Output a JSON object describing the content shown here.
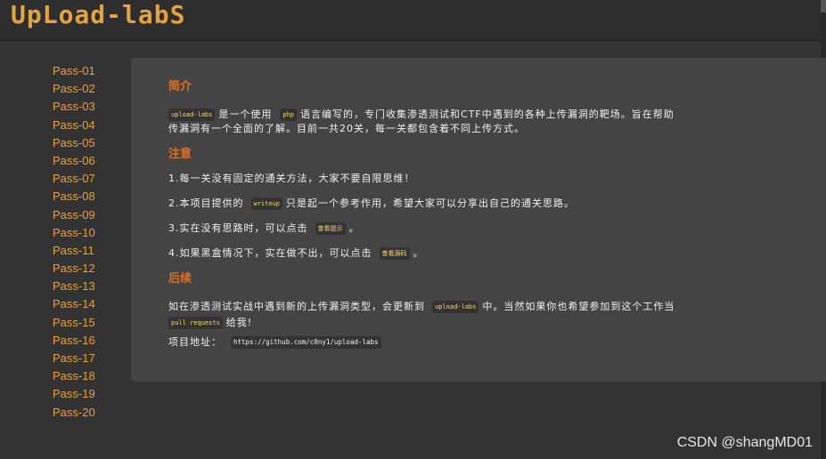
{
  "header": {
    "logo_text": "UpLoad-labS"
  },
  "sidebar": {
    "items": [
      {
        "label": "Pass-01"
      },
      {
        "label": "Pass-02"
      },
      {
        "label": "Pass-03"
      },
      {
        "label": "Pass-04"
      },
      {
        "label": "Pass-05"
      },
      {
        "label": "Pass-06"
      },
      {
        "label": "Pass-07"
      },
      {
        "label": "Pass-08"
      },
      {
        "label": "Pass-09"
      },
      {
        "label": "Pass-10"
      },
      {
        "label": "Pass-11"
      },
      {
        "label": "Pass-12"
      },
      {
        "label": "Pass-13"
      },
      {
        "label": "Pass-14"
      },
      {
        "label": "Pass-15"
      },
      {
        "label": "Pass-16"
      },
      {
        "label": "Pass-17"
      },
      {
        "label": "Pass-18"
      },
      {
        "label": "Pass-19"
      },
      {
        "label": "Pass-20"
      }
    ]
  },
  "intro": {
    "title": "简介",
    "code_project": "upload-labs",
    "text_a": "是一个使用",
    "code_php": "php",
    "text_b": "语言编写的，专门收集渗透测试和CTF中遇到的各种上传漏洞的靶场。旨在帮助",
    "line2": "传漏洞有一个全面的了解。目前一共20关，每一关都包含着不同上传方式。"
  },
  "notes": {
    "title": "注意",
    "item1": "1.每一关没有固定的通关方法，大家不要自限思维！",
    "item2_a": "2.本项目提供的",
    "item2_code": "writeup",
    "item2_b": "只是起一个参考作用，希望大家可以分享出自己的通关思路。",
    "item3_a": "3.实在没有思路时，可以点击",
    "item3_code": "查看提示",
    "item3_b": "。",
    "item4_a": "4.如果黑盒情况下，实在做不出，可以点击",
    "item4_code": "查看源码",
    "item4_b": "。"
  },
  "followup": {
    "title": "后续",
    "text_a": "如在渗透测试实战中遇到新的上传漏洞类型，会更新到",
    "code_project": "upload-labs",
    "text_b": "中。当然如果你也希望参加到这个工作当",
    "code_pr": "pull requests",
    "text_c": "给我!",
    "address_label": "项目地址：",
    "address_url": "https://github.com/c0ny1/upload-labs"
  },
  "watermark": {
    "text": "CSDN @shangMD01"
  },
  "colors": {
    "background": "#333333",
    "panel": "#444444",
    "logo": "#e0a445",
    "sidebar_link": "#e8a040",
    "section_title": "#e36d1f",
    "code_text": "#ffd86b"
  }
}
